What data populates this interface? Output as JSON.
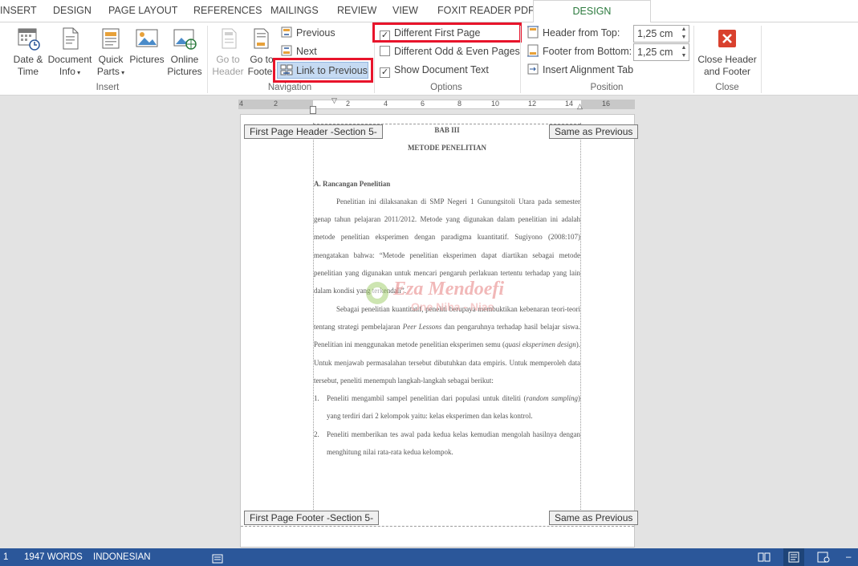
{
  "tabs": [
    {
      "label": "INSERT"
    },
    {
      "label": "DESIGN"
    },
    {
      "label": "PAGE LAYOUT"
    },
    {
      "label": "REFERENCES"
    },
    {
      "label": "MAILINGS"
    },
    {
      "label": "REVIEW"
    },
    {
      "label": "VIEW"
    },
    {
      "label": "FOXIT READER PDF"
    },
    {
      "label": "DESIGN",
      "active": true
    }
  ],
  "ribbon": {
    "insert": {
      "group_label": "Insert",
      "date_time": {
        "line1": "Date &",
        "line2": "Time"
      },
      "document_info": {
        "line1": "Document",
        "line2": "Info"
      },
      "quick_parts": {
        "line1": "Quick",
        "line2": "Parts"
      },
      "pictures": {
        "line1": "Pictures"
      },
      "online_pictures": {
        "line1": "Online",
        "line2": "Pictures"
      }
    },
    "navigation": {
      "group_label": "Navigation",
      "go_to_header": {
        "line1": "Go to",
        "line2": "Header"
      },
      "go_to_footer": {
        "line1": "Go to",
        "line2": "Footer"
      },
      "previous": "Previous",
      "next": "Next",
      "link_to_previous": "Link to Previous"
    },
    "options": {
      "group_label": "Options",
      "different_first_page": "Different First Page",
      "different_odd_even": "Different Odd & Even Pages",
      "show_document_text": "Show Document Text",
      "different_first_page_checked": true,
      "different_odd_even_checked": false,
      "show_document_text_checked": true
    },
    "position": {
      "group_label": "Position",
      "header_from_top_label": "Header from Top:",
      "header_from_top_value": "1,25 cm",
      "footer_from_bottom_label": "Footer from Bottom:",
      "footer_from_bottom_value": "1,25 cm",
      "insert_alignment_tab": "Insert Alignment Tab"
    },
    "close": {
      "group_label": "Close",
      "close_line1": "Close Header",
      "close_line2": "and Footer"
    }
  },
  "ruler": {
    "ticks": [
      "4",
      "2",
      "2",
      "4",
      "6",
      "8",
      "10",
      "12",
      "14",
      "16"
    ]
  },
  "page": {
    "header_tag": "First Page Header -Section 5-",
    "header_same": "Same as Previous",
    "footer_tag": "First Page Footer -Section 5-",
    "footer_same": "Same as Previous",
    "chapter": "BAB III",
    "chapter_title": "METODE PENELITIAN",
    "section_a": "A.  Rancangan Penelitian",
    "para1": "Penelitian ini dilaksanakan di SMP Negeri 1 Gunungsitoli Utara pada semester genap tahun pelajaran 2011/2012. Metode yang digunakan dalam penelitian ini adalah metode penelitian eksperimen dengan paradigma kuantitatif. Sugiyono (2008:107) mengatakan bahwa: “Metode penelitian eksperimen dapat diartikan sebagai metode penelitian yang digunakan untuk mencari pengaruh perlakuan tertentu terhadap yang lain dalam kondisi yang terkendali”.",
    "para2_a": "Sebagai penelitian kuantitatif, peneliti berupaya membuktikan kebenaran teori-teori tentang strategi pembelajaran ",
    "para2_em1": "Peer Lessons",
    "para2_b": " dan pengaruhnya terhadap hasil belajar siswa. Penelitian ini menggunakan metode penelitian eksperimen semu (",
    "para2_em2": "quasi eksperimen design",
    "para2_c": "). Untuk menjawab permasalahan tersebut dibutuhkan data empiris. Untuk memperoleh data tersebut, peneliti menempuh langkah-langkah sebagai berikut:",
    "list": [
      {
        "num": "1.",
        "a": "Peneliti mengambil sampel penelitian dari populasi untuk diteliti (",
        "em": "random sampling",
        "b": ") yang terdiri dari 2 kelompok yaitu: kelas eksperimen dan kelas kontrol."
      },
      {
        "num": "2.",
        "a": "Peneliti memberikan tes awal pada kedua kelas kemudian mengolah hasilnya dengan menghitung nilai rata-rata kedua kelompok.",
        "em": "",
        "b": ""
      }
    ],
    "watermark_line1": "Eza Mendoefi",
    "watermark_line2": "One Niha - Nias"
  },
  "status": {
    "page": "1",
    "words": "1947 WORDS",
    "language": "INDONESIAN"
  },
  "colors": {
    "accent": "#2b7a3d",
    "status_bar": "#2b579a",
    "highlight": "#e8142b",
    "close_red": "#d9412e"
  }
}
